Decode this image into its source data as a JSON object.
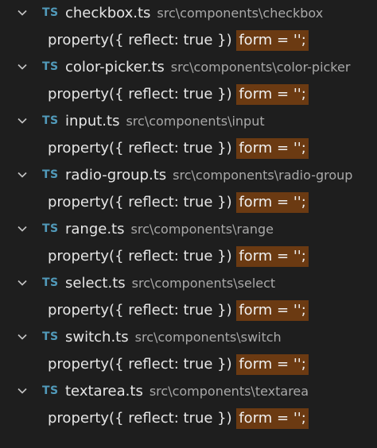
{
  "colors": {
    "background": "#1e1e1e",
    "ts_badge": "#519aba",
    "highlight": "#6b3a12"
  },
  "icons": {
    "expand": "chevron-down-icon",
    "file_type": "typescript-icon"
  },
  "results": [
    {
      "badge": "TS",
      "file": "checkbox.ts",
      "path": "src\\components\\checkbox",
      "prefix": "property({ reflect: true }) ",
      "match": "form = '';"
    },
    {
      "badge": "TS",
      "file": "color-picker.ts",
      "path": "src\\components\\color-picker",
      "prefix": "property({ reflect: true }) ",
      "match": "form = '';"
    },
    {
      "badge": "TS",
      "file": "input.ts",
      "path": "src\\components\\input",
      "prefix": "property({ reflect: true }) ",
      "match": "form = '';"
    },
    {
      "badge": "TS",
      "file": "radio-group.ts",
      "path": "src\\components\\radio-group",
      "prefix": "property({ reflect: true }) ",
      "match": "form = '';"
    },
    {
      "badge": "TS",
      "file": "range.ts",
      "path": "src\\components\\range",
      "prefix": "property({ reflect: true }) ",
      "match": "form = '';"
    },
    {
      "badge": "TS",
      "file": "select.ts",
      "path": "src\\components\\select",
      "prefix": "property({ reflect: true }) ",
      "match": "form = '';"
    },
    {
      "badge": "TS",
      "file": "switch.ts",
      "path": "src\\components\\switch",
      "prefix": "property({ reflect: true }) ",
      "match": "form = '';"
    },
    {
      "badge": "TS",
      "file": "textarea.ts",
      "path": "src\\components\\textarea",
      "prefix": "property({ reflect: true }) ",
      "match": "form = '';"
    }
  ]
}
